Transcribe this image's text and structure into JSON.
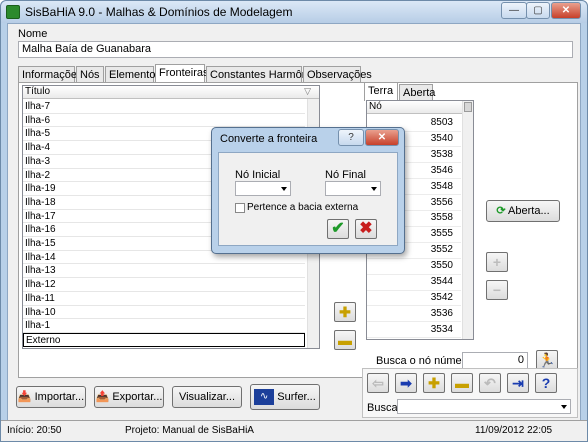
{
  "window": {
    "title": "SisBaHiA 9.0 - Malhas & Domínios de Modelagem",
    "min_label": "—",
    "max_label": "▢",
    "close_label": "✕"
  },
  "name_field": {
    "label": "Nome",
    "value": "Malha Baía de Guanabara"
  },
  "tabs": [
    {
      "label": "Informações"
    },
    {
      "label": "Nós"
    },
    {
      "label": "Elementos"
    },
    {
      "label": "Fronteiras"
    },
    {
      "label": "Constantes Harmônicas"
    },
    {
      "label": "Observações"
    }
  ],
  "boundary_list": {
    "column_header": "Título",
    "rows": [
      "Ilha-7",
      "Ilha-6",
      "Ilha-5",
      "Ilha-4",
      "Ilha-3",
      "Ilha-2",
      "Ilha-19",
      "Ilha-18",
      "Ilha-17",
      "Ilha-16",
      "Ilha-15",
      "Ilha-14",
      "Ilha-13",
      "Ilha-12",
      "Ilha-11",
      "Ilha-10",
      "Ilha-1",
      "Externo"
    ]
  },
  "right_panel": {
    "tabs": [
      {
        "label": "Terra"
      },
      {
        "label": "Aberta"
      }
    ],
    "column_header": "Nó",
    "nodes": [
      "8503",
      "3540",
      "3538",
      "3546",
      "3548",
      "3556",
      "3558",
      "3555",
      "3552",
      "3550",
      "3544",
      "3542",
      "3536",
      "3534"
    ],
    "aberta_button": "Aberta...",
    "search_label": "Busca o nó número:",
    "search_value": "0"
  },
  "bottom_buttons": {
    "importar": "Importar...",
    "exportar": "Exportar...",
    "visualizar": "Visualizar...",
    "surfer": "Surfer..."
  },
  "nav_toolbar": {
    "search_label": "Busca:"
  },
  "status_bar": {
    "inicio": "Início: 20:50",
    "projeto": "Projeto: Manual de SisBaHiA",
    "datetime": "11/09/2012 22:05"
  },
  "dialog": {
    "title": "Converte a fronteira",
    "help_label": "?",
    "close_label": "✕",
    "no_inicial_label": "Nó Inicial",
    "no_final_label": "Nó Final",
    "checkbox_label": "Pertence a bacia externa"
  },
  "colors": {
    "accent_green": "#1f9a2a",
    "accent_red": "#c81e1e",
    "title_blue": "#b8d0e8"
  }
}
